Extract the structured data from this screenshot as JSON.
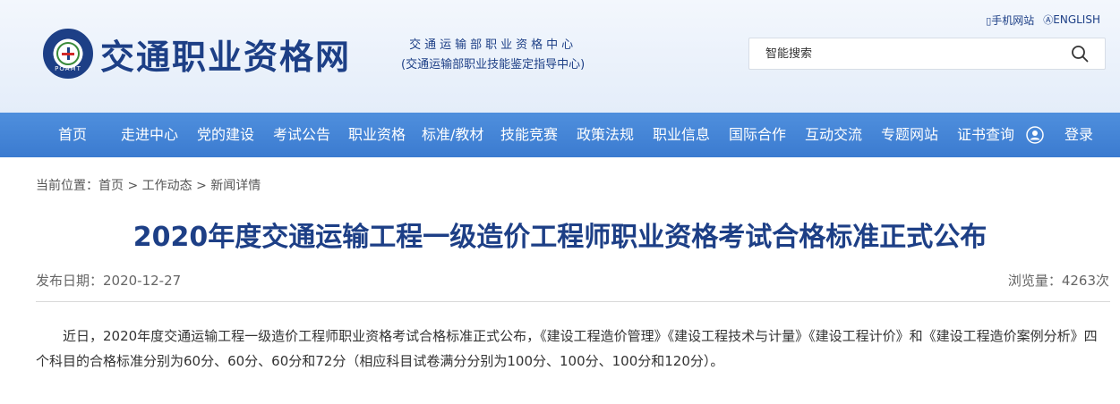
{
  "header": {
    "site_title": "交通职业资格网",
    "logo_ring_text": "POAMT",
    "subtitle_line1": "交通运输部职业资格中心",
    "subtitle_line2": "(交通运输部职业技能鉴定指导中心)",
    "mobile_link": "手机网站",
    "english_link": "ENGLISH",
    "search_placeholder": "智能搜索"
  },
  "nav": {
    "items": [
      "首页",
      "走进中心",
      "党的建设",
      "考试公告",
      "职业资格",
      "标准/教材",
      "技能竞赛",
      "政策法规",
      "职业信息",
      "国际合作",
      "互动交流",
      "专题网站",
      "证书查询",
      "登录"
    ]
  },
  "breadcrumb": {
    "prefix": "当前位置：",
    "home": "首页",
    "sep": ">",
    "section": "工作动态",
    "current": "新闻详情"
  },
  "article": {
    "title": "2020年度交通运输工程一级造价工程师职业资格考试合格标准正式公布",
    "date_label": "发布日期：2020-12-27",
    "views_label": "浏览量：4263次",
    "body": "近日，2020年度交通运输工程一级造价工程师职业资格考试合格标准正式公布，《建设工程造价管理》《建设工程技术与计量》《建设工程计价》和《建设工程造价案例分析》四个科目的合格标准分别为60分、60分、60分和72分（相应科目试卷满分分别为100分、100分、100分和120分）。"
  },
  "colors": {
    "brand": "#1d3f86",
    "nav_bg": "#4584d6"
  }
}
